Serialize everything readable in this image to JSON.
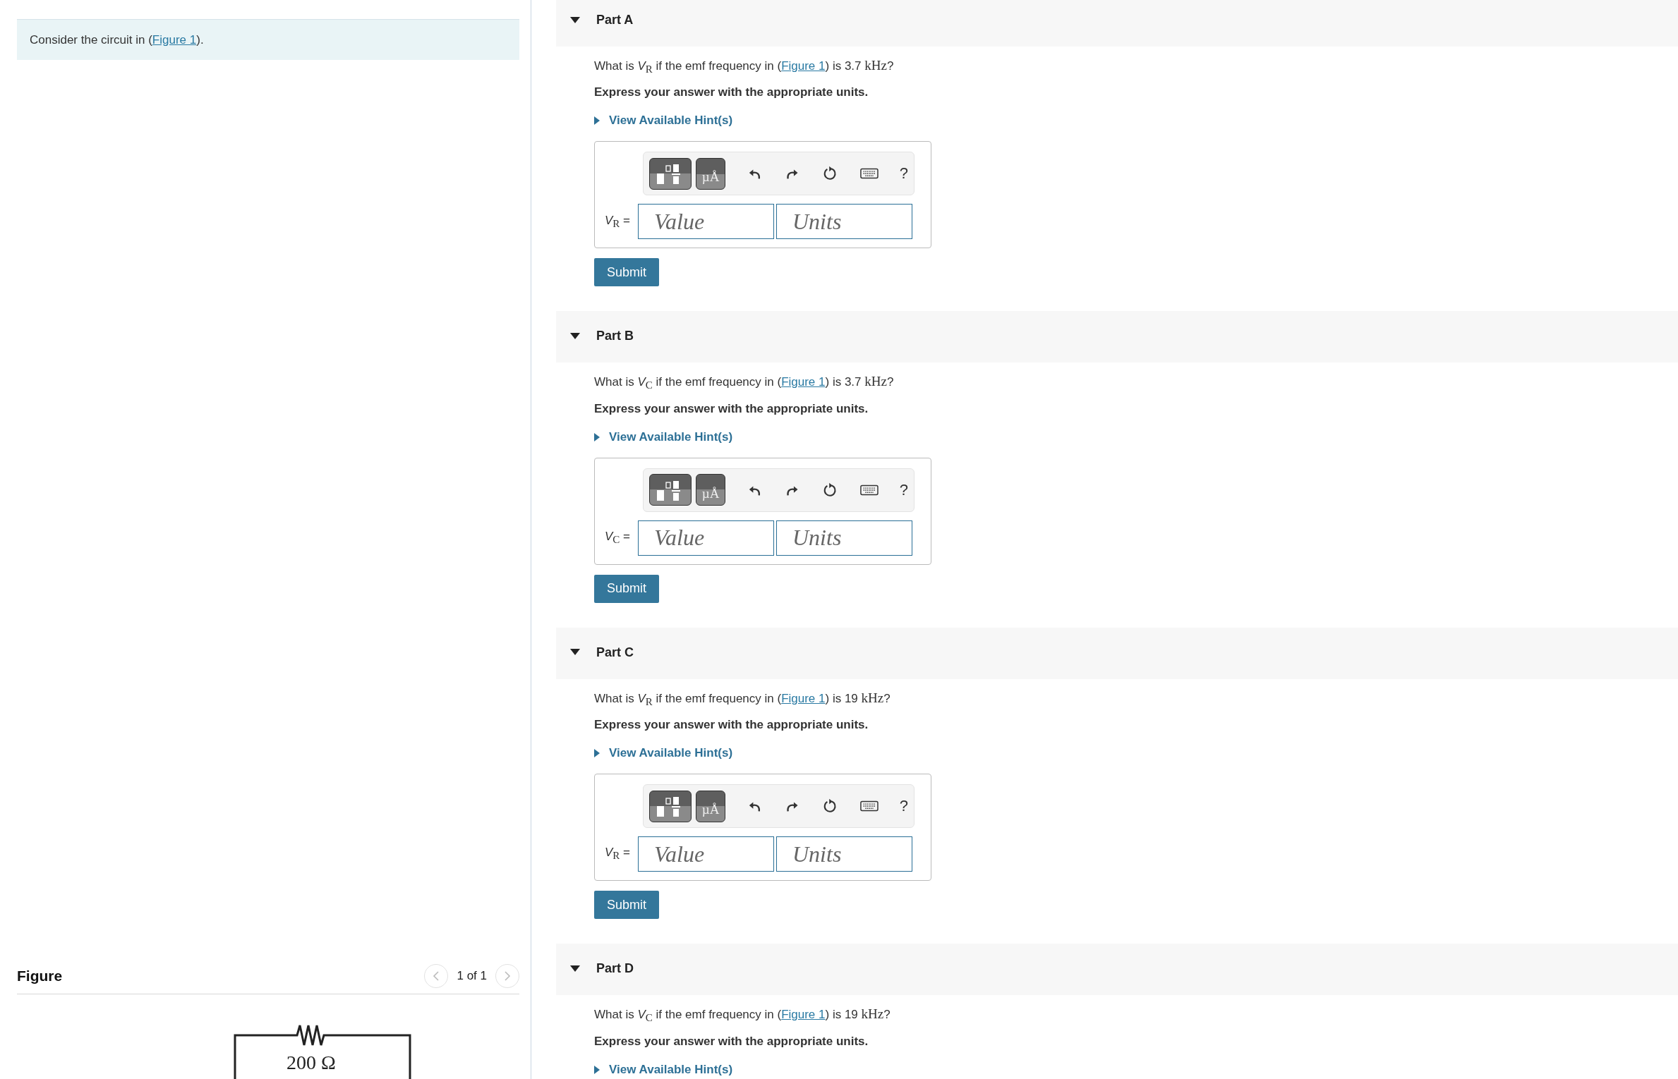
{
  "intro": {
    "before": "Consider the circuit in (",
    "link": "Figure 1",
    "after": ")."
  },
  "figure": {
    "title": "Figure",
    "pager": "1 of 1",
    "resistor_label": "200 Ω"
  },
  "parts": [
    {
      "title": "Part A",
      "expanded": true,
      "kind": "full",
      "question": {
        "before": "What is *V*$_{R}$ if the emf frequency in (",
        "link": "Figure 1",
        "after": ") is 3.7",
        "unit": "kHz",
        "end": "?"
      },
      "instruction": "Express your answer with the appropriate units.",
      "hint": "View Available Hint(s)",
      "answer": {
        "label": "*V*$_{R}$ =",
        "units_key": "µÅ",
        "help": "?",
        "value_placeholder": "Value",
        "units_placeholder": "Units",
        "submit": "Submit"
      }
    },
    {
      "title": "Part B",
      "expanded": true,
      "kind": "full",
      "question": {
        "before": "What is *V*$_{C}$ if the emf frequency in (",
        "link": "Figure 1",
        "after": ") is 3.7",
        "unit": "kHz",
        "end": "?"
      },
      "instruction": "Express your answer with the appropriate units.",
      "hint": "View Available Hint(s)",
      "answer": {
        "label": "*V*$_{C}$ =",
        "units_key": "µÅ",
        "help": "?",
        "value_placeholder": "Value",
        "units_placeholder": "Units",
        "submit": "Submit"
      }
    },
    {
      "title": "Part C",
      "expanded": true,
      "kind": "full",
      "question": {
        "before": "What is *V*$_{R}$ if the emf frequency in (",
        "link": "Figure 1",
        "after": ") is 19",
        "unit": "kHz",
        "end": "?"
      },
      "instruction": "Express your answer with the appropriate units.",
      "hint": "View Available Hint(s)",
      "answer": {
        "label": "*V*$_{R}$ =",
        "units_key": "µÅ",
        "help": "?",
        "value_placeholder": "Value",
        "units_placeholder": "Units",
        "submit": "Submit"
      }
    },
    {
      "title": "Part D",
      "expanded": true,
      "kind": "cut",
      "question": {
        "before": "What is *V*$_{C}$ if the emf frequency in (",
        "link": "Figure 1",
        "after": ") is 19",
        "unit": "kHz",
        "end": "?"
      },
      "instruction": "Express your answer with the appropriate units.",
      "hint": "View Available Hint(s)"
    }
  ]
}
